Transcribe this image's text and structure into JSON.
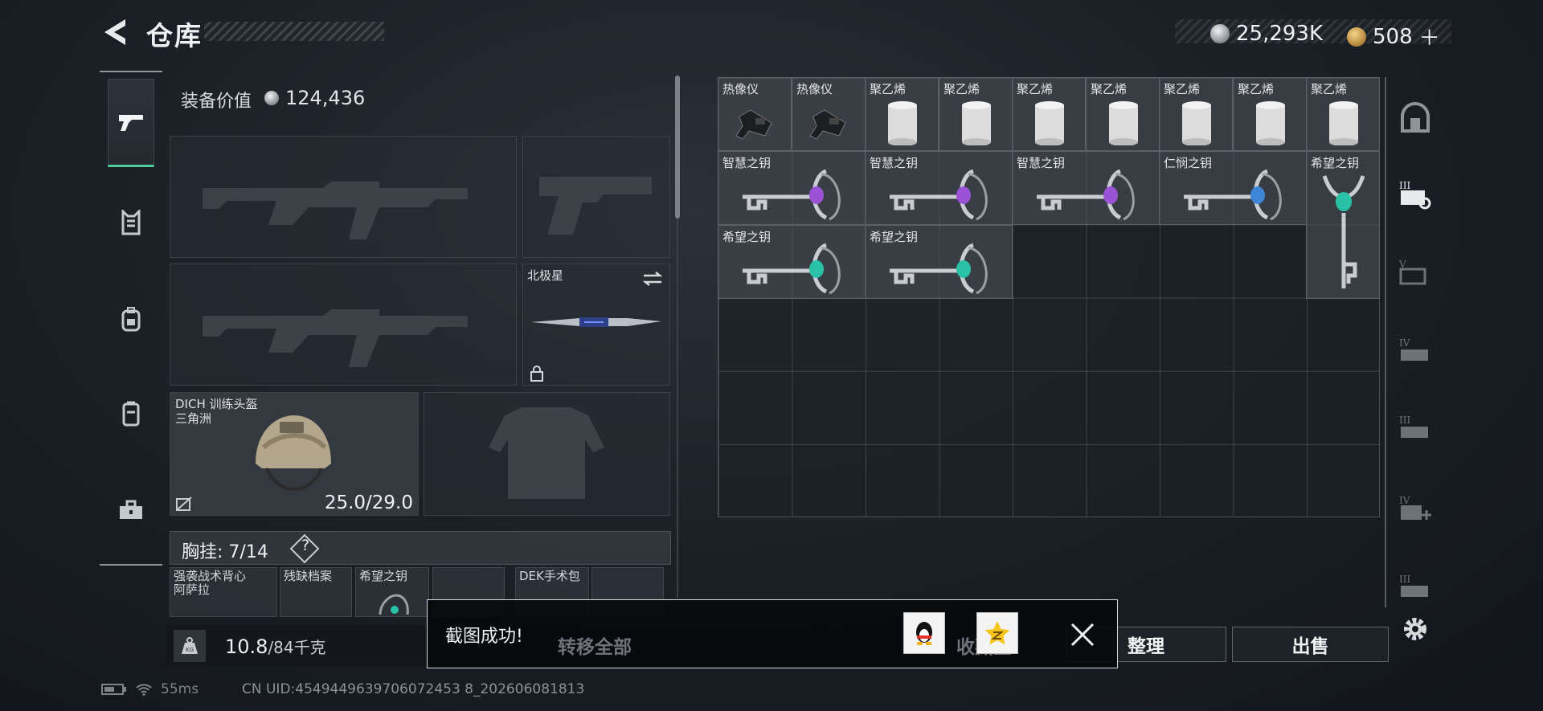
{
  "header": {
    "title": "仓库",
    "currency": [
      {
        "icon": "silver-coin-icon",
        "amount": "25,293K"
      },
      {
        "icon": "gold-coin-icon",
        "amount": "508",
        "action": "＋"
      }
    ]
  },
  "left_rail": {
    "items": [
      {
        "icon": "pistol-icon",
        "active": true
      },
      {
        "icon": "vest-icon",
        "active": false
      },
      {
        "icon": "backpack-icon",
        "active": false
      },
      {
        "icon": "locker-icon",
        "active": false
      },
      {
        "icon": "toolbox-icon",
        "active": false
      }
    ]
  },
  "equipment": {
    "value_label": "装备价值",
    "value_amount": "124,436",
    "melee_slot": {
      "name": "北极星",
      "swap_icon": "swap-icon",
      "locked": true
    },
    "helmet_slot": {
      "name": "DICH 训练头盔",
      "brand": "三角洲",
      "durability": "25.0/29.0"
    },
    "chest_rig": {
      "label": "胸挂:",
      "capacity": "7/14",
      "help": "?"
    },
    "chest_items": [
      {
        "name": "强袭战术背心",
        "sub": "阿萨拉"
      },
      {
        "name": "残缺档案",
        "sub": ""
      },
      {
        "name": "希望之钥",
        "sub": ""
      },
      {
        "name": "",
        "sub": ""
      },
      {
        "name": "DEK手术包",
        "sub": ""
      },
      {
        "name": "",
        "sub": ""
      }
    ],
    "weight": {
      "current": "10.8",
      "max_unit": "/84千克"
    }
  },
  "stash": {
    "row1": [
      "热像仪",
      "热像仪",
      "聚乙烯",
      "聚乙烯",
      "聚乙烯",
      "聚乙烯",
      "聚乙烯",
      "聚乙烯",
      "聚乙烯"
    ],
    "keys": [
      {
        "name": "智慧之钥",
        "gem": "#9b52d6"
      },
      {
        "name": "智慧之钥",
        "gem": "#9b52d6"
      },
      {
        "name": "智慧之钥",
        "gem": "#9b52d6"
      },
      {
        "name": "仁悯之钥",
        "gem": "#3f86d8"
      },
      {
        "name": "希望之钥",
        "gem": "#29c2a8"
      },
      {
        "name": "希望之钥",
        "gem": "#29c2a8"
      },
      {
        "name": "希望之钥",
        "gem": "#29c2a8"
      }
    ]
  },
  "category_rail": {
    "items": [
      "safe-icon",
      "tier-3-case-icon",
      "tier-5-case-icon",
      "tier-4-case-icon",
      "tier-3-case-icon",
      "tier-4-medical-case-icon",
      "tier-3-case-icon"
    ],
    "settings_icon": "gear-icon"
  },
  "buttons": {
    "sort": "整理",
    "sell": "出售",
    "transfer_all": "转移全部",
    "collect": "收藏室"
  },
  "toast": {
    "message": "截图成功!",
    "share_qq_icon": "qq-penguin-icon",
    "share_qzone_icon": "qzone-star-icon",
    "close_icon": "close-icon"
  },
  "status": {
    "ping": "55ms",
    "uid": "CN UID:4549449639706072453 8_202606081813"
  }
}
